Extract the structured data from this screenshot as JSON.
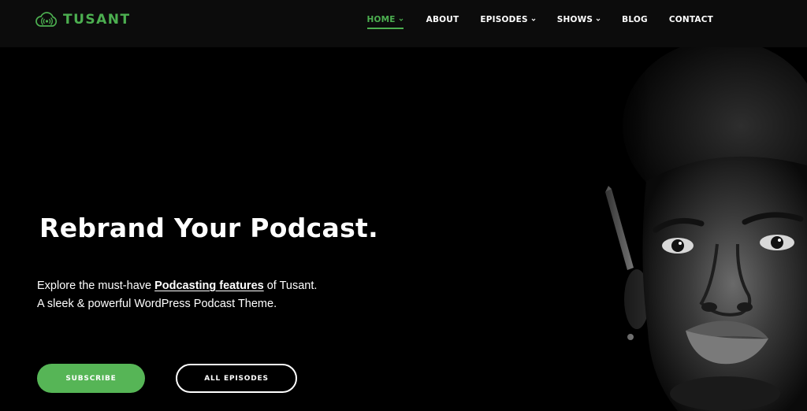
{
  "brand": {
    "name": "TUSANT",
    "accent_color": "#4caf50",
    "logo_icon": "broadcast-cloud-icon"
  },
  "nav": {
    "items": [
      {
        "label": "HOME",
        "dropdown": true,
        "active": true
      },
      {
        "label": "ABOUT",
        "dropdown": false,
        "active": false
      },
      {
        "label": "EPISODES",
        "dropdown": true,
        "active": false
      },
      {
        "label": "SHOWS",
        "dropdown": true,
        "active": false
      },
      {
        "label": "BLOG",
        "dropdown": false,
        "active": false
      },
      {
        "label": "CONTACT",
        "dropdown": false,
        "active": false
      }
    ]
  },
  "hero": {
    "title": "Rebrand Your Podcast.",
    "desc_prefix": "Explore the must-have ",
    "desc_link": "Podcasting features",
    "desc_suffix": " of Tusant.",
    "desc_line2": "A sleek & powerful WordPress Podcast Theme.",
    "image": "man-portrait-photo",
    "buttons": {
      "subscribe": "SUBSCRIBE",
      "all_episodes": "ALL EPISODES"
    },
    "button_color": "#56b556"
  }
}
